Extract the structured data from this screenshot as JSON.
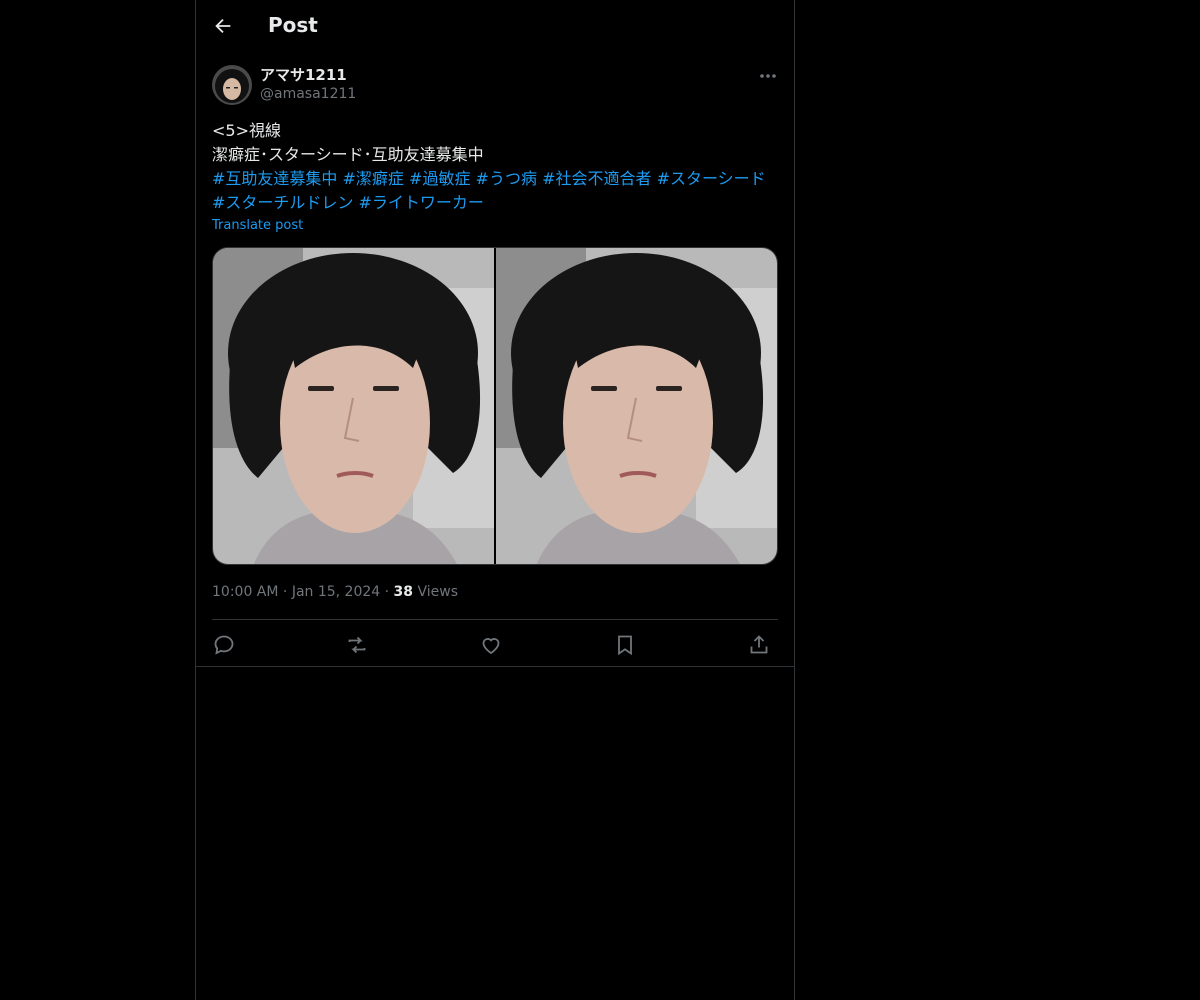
{
  "header": {
    "title": "Post"
  },
  "author": {
    "display_name": "アマサ1211",
    "handle": "@amasa1211"
  },
  "post": {
    "line1": "<5>視線",
    "line2": "潔癖症･スターシード･互助友達募集中",
    "hashtags": [
      "#互助友達募集中",
      "#潔癖症",
      "#過敏症",
      "#うつ病",
      "#社会不適合者",
      "#スターシード",
      "#スターチルドレン",
      "#ライトワーカー"
    ],
    "translate_label": "Translate post"
  },
  "meta": {
    "time": "10:00 AM",
    "date": "Jan 15, 2024",
    "views_count": "38",
    "views_label": "Views",
    "separator": "·"
  },
  "colors": {
    "background": "#000000",
    "text": "#e7e9ea",
    "secondary": "#71767b",
    "accent": "#1d9bf0",
    "border": "#2f3336"
  }
}
